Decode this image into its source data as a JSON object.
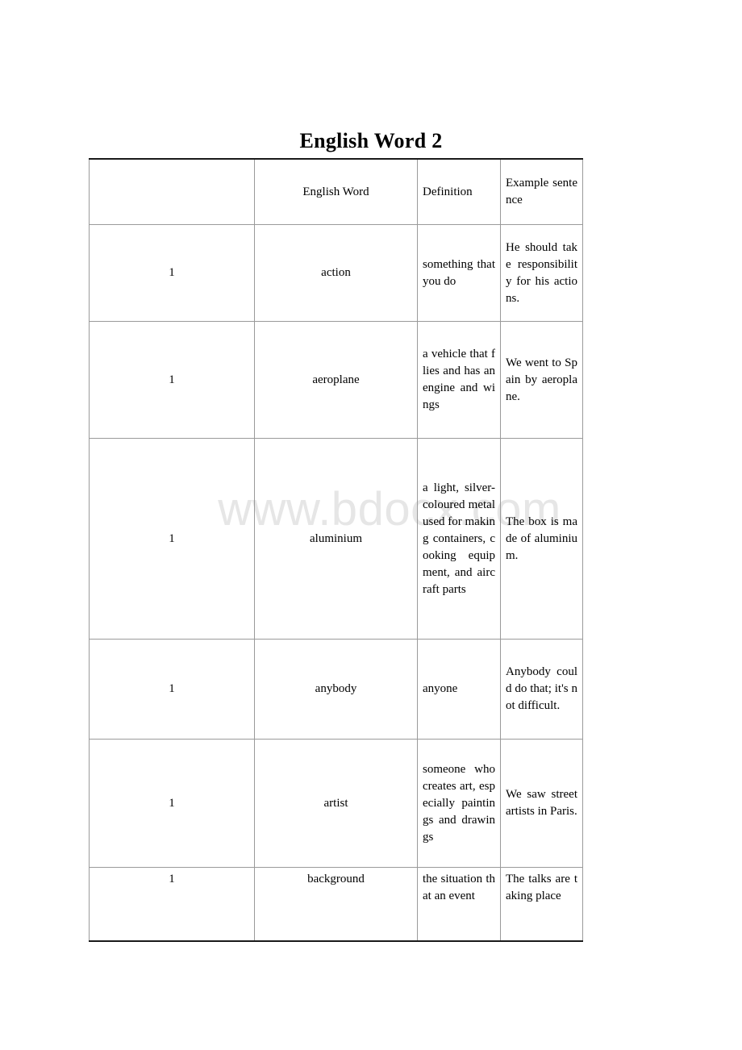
{
  "document": {
    "title": "English Word 2",
    "watermark": "www.bdocx.com"
  },
  "table": {
    "headers": {
      "number": "",
      "word": "English Word",
      "definition": "Definition",
      "example": "Example sentence"
    },
    "rows": [
      {
        "number": "1",
        "word": "action",
        "definition": "something that you do",
        "example": "He should take responsibility for his actions."
      },
      {
        "number": "1",
        "word": "aeroplane",
        "definition": "a vehicle that flies and has an engine and wings",
        "example": "We went to Spain by aeroplane."
      },
      {
        "number": "1",
        "word": "aluminium",
        "definition": "a light, silver-coloured metal used for making containers, cooking equipment, and aircraft parts",
        "example": "The box is made of aluminium."
      },
      {
        "number": "1",
        "word": "anybody",
        "definition": "anyone",
        "example": "Anybody could do that; it's not difficult."
      },
      {
        "number": "1",
        "word": "artist",
        "definition": "someone who creates art, especially paintings and drawings",
        "example": "We saw street artists in Paris."
      },
      {
        "number": "1",
        "word": "background",
        "definition": "the situation that an event",
        "example": "The talks are taking place"
      }
    ]
  }
}
